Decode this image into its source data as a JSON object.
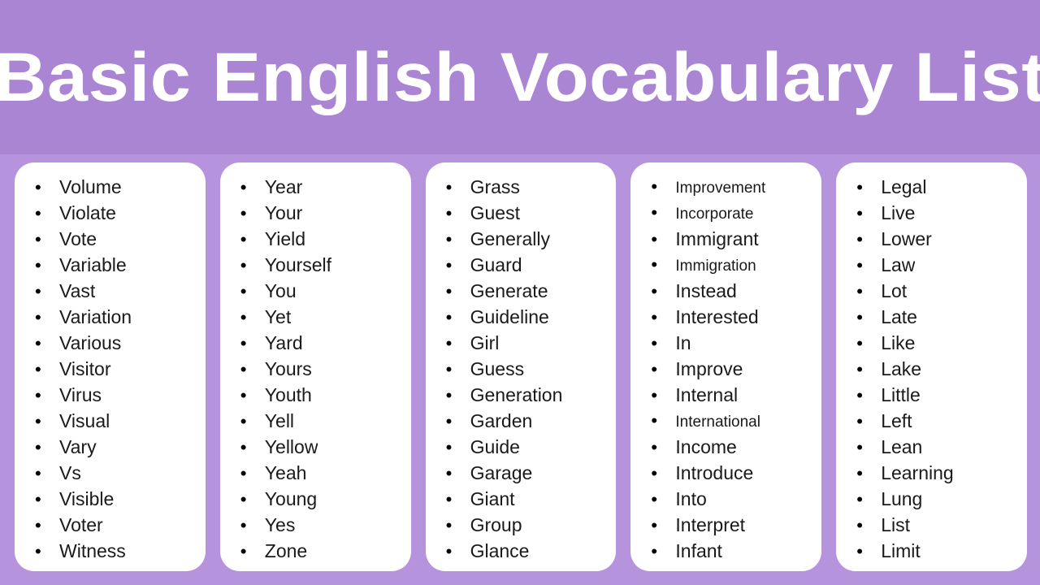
{
  "header": {
    "title": "Basic English Vocabulary List",
    "band_color": "#aa85d4"
  },
  "theme": {
    "background_color": "#b593dd",
    "card_color": "#ffffff",
    "title_color": "#ffffff",
    "text_color": "#1a1a1a",
    "bullet_glyph": "•"
  },
  "columns": [
    {
      "name": "column-v-words",
      "words": [
        "Volume",
        "Violate",
        "Vote",
        "Variable",
        "Vast",
        "Variation",
        "Various",
        "Visitor",
        "Virus",
        "Visual",
        "Vary",
        "Vs",
        "Visible",
        "Voter",
        "Witness"
      ]
    },
    {
      "name": "column-y-words",
      "words": [
        "Year",
        "Your",
        "Yield",
        "Yourself",
        "You",
        "Yet",
        "Yard",
        "Yours",
        "Youth",
        "Yell",
        "Yellow",
        "Yeah",
        "Young",
        "Yes",
        "Zone"
      ]
    },
    {
      "name": "column-g-words",
      "words": [
        "Grass",
        "Guest",
        "Generally",
        "Guard",
        "Generate",
        "Guideline",
        "Girl",
        "Guess",
        "Generation",
        "Garden",
        "Guide",
        "Garage",
        "Giant",
        "Group",
        "Glance"
      ]
    },
    {
      "name": "column-i-words",
      "words": [
        "Improvement",
        "Incorporate",
        "Immigrant",
        "Immigration",
        "Instead",
        "Interested",
        "In",
        "Improve",
        "Internal",
        "International",
        "Income",
        "Introduce",
        "Into",
        "Interpret",
        "Infant"
      ]
    },
    {
      "name": "column-l-words",
      "words": [
        "Legal",
        "Live",
        "Lower",
        "Law",
        "Lot",
        "Late",
        "Like",
        "Lake",
        "Little",
        "Left",
        "Lean",
        "Learning",
        "Lung",
        "List",
        "Limit"
      ]
    }
  ]
}
